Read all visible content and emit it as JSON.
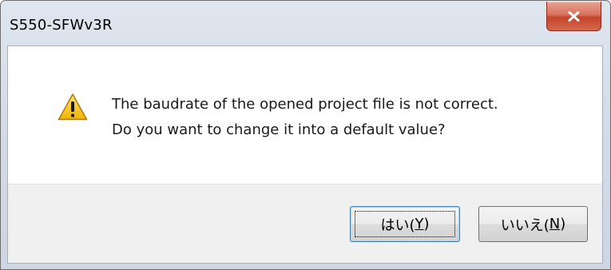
{
  "window": {
    "title": "S550-SFWv3R"
  },
  "message": {
    "line1": "The baudrate of the opened project file is not correct.",
    "line2": "Do you want to change it into a default value?",
    "icon": "warning-icon"
  },
  "buttons": {
    "yes": {
      "prefix": "はい(",
      "mnemonic": "Y",
      "suffix": ")"
    },
    "no": {
      "prefix": "いいえ(",
      "mnemonic": "N",
      "suffix": ")"
    }
  },
  "colors": {
    "close_button": "#c5432b",
    "warning_fill": "#f5c518",
    "default_button_border": "#3c7fb1"
  }
}
